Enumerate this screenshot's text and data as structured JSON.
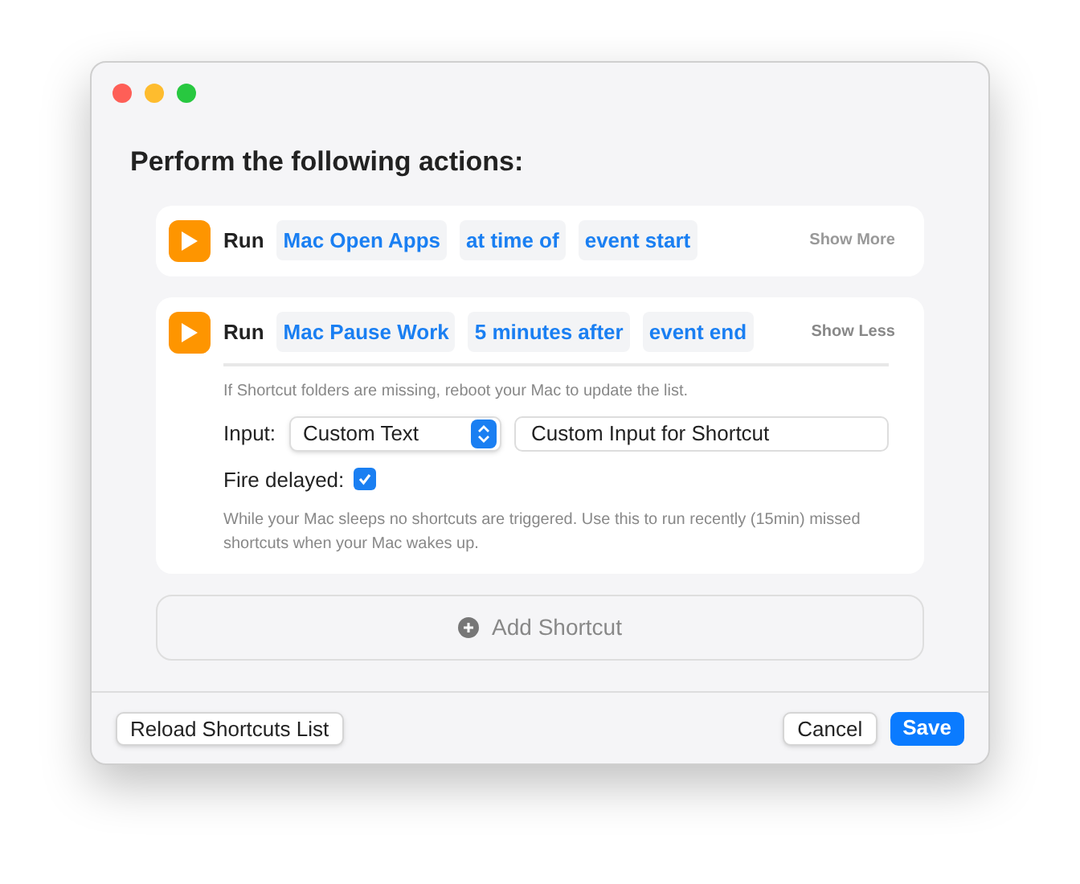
{
  "heading": "Perform the following actions:",
  "actions": [
    {
      "label": "Run",
      "shortcut": "Mac Open Apps",
      "timing": "at time of",
      "event": "event start",
      "toggle": "Show More",
      "expanded": false
    },
    {
      "label": "Run",
      "shortcut": "Mac Pause Work",
      "timing": "5 minutes after",
      "event": "event end",
      "toggle": "Show Less",
      "expanded": true,
      "details": {
        "note": "If Shortcut folders are missing, reboot your Mac to update the list.",
        "input_label": "Input:",
        "input_type": "Custom Text",
        "input_value": "Custom Input for Shortcut",
        "fire_label": "Fire delayed:",
        "fire_delayed": true,
        "fire_note": "While your Mac sleeps no shortcuts are triggered. Use this to run recently (15min) missed shortcuts when your Mac wakes up."
      }
    }
  ],
  "add_button": "Add Shortcut",
  "footer": {
    "reload": "Reload Shortcuts List",
    "cancel": "Cancel",
    "save": "Save"
  }
}
